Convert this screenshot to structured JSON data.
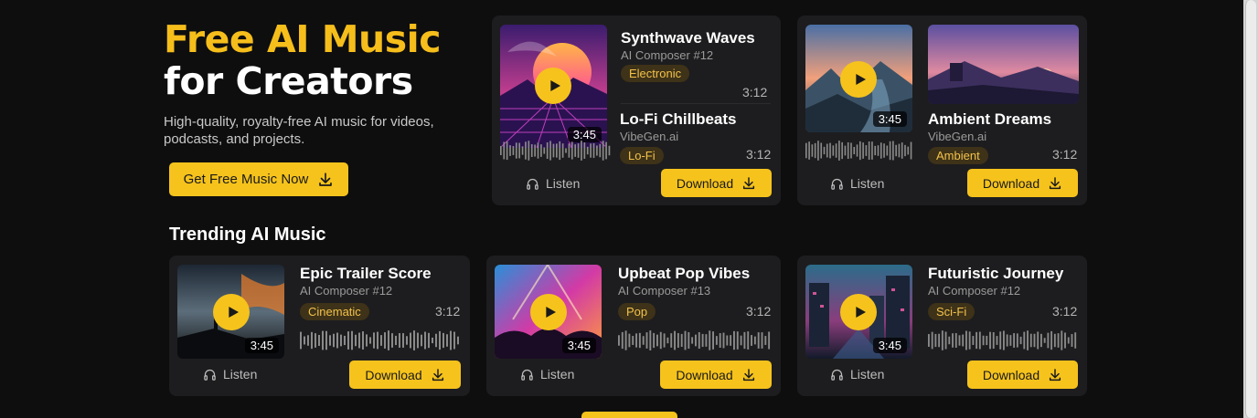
{
  "hero": {
    "title_line1": "Free AI Music",
    "title_line2": "for Creators",
    "subtitle": "High-quality, royalty-free AI music for videos, podcasts, and projects.",
    "cta_label": "Get Free Music Now"
  },
  "trending_title": "Trending AI Music",
  "featured": {
    "synthwave": {
      "title": "Synthwave Waves",
      "artist": "AI Composer #12",
      "genre": "Electronic",
      "time": "3:12",
      "duration": "3:45"
    },
    "lofi": {
      "title": "Lo-Fi Chillbeats",
      "artist": "VibeGen.ai",
      "genre": "Lo-Fi",
      "time": "3:12"
    },
    "listen_label": "Listen",
    "download_label": "Download"
  },
  "ambient_card": {
    "duration": "3:45",
    "title": "Ambient Dreams",
    "artist": "VibeGen.ai",
    "genre": "Ambient",
    "time": "3:12",
    "listen_label": "Listen",
    "download_label": "Download"
  },
  "tracks": [
    {
      "title": "Epic Trailer Score",
      "artist": "AI Composer #12",
      "genre": "Cinematic",
      "time": "3:12",
      "duration": "3:45",
      "listen_label": "Listen",
      "download_label": "Download"
    },
    {
      "title": "Upbeat Pop Vibes",
      "artist": "AI Composer #13",
      "genre": "Pop",
      "time": "3:12",
      "duration": "3:45",
      "listen_label": "Listen",
      "download_label": "Download"
    },
    {
      "title": "Futuristic Journey",
      "artist": "AI Composer #12",
      "genre": "Sci-Fi",
      "time": "3:12",
      "duration": "3:45",
      "listen_label": "Listen",
      "download_label": "Download"
    }
  ],
  "icons": {
    "play": "play-icon",
    "download": "download-icon",
    "headphones": "headphones-icon"
  },
  "colors": {
    "accent": "#f6c31c",
    "background": "#0e0e0f",
    "card": "#1d1d1f"
  }
}
